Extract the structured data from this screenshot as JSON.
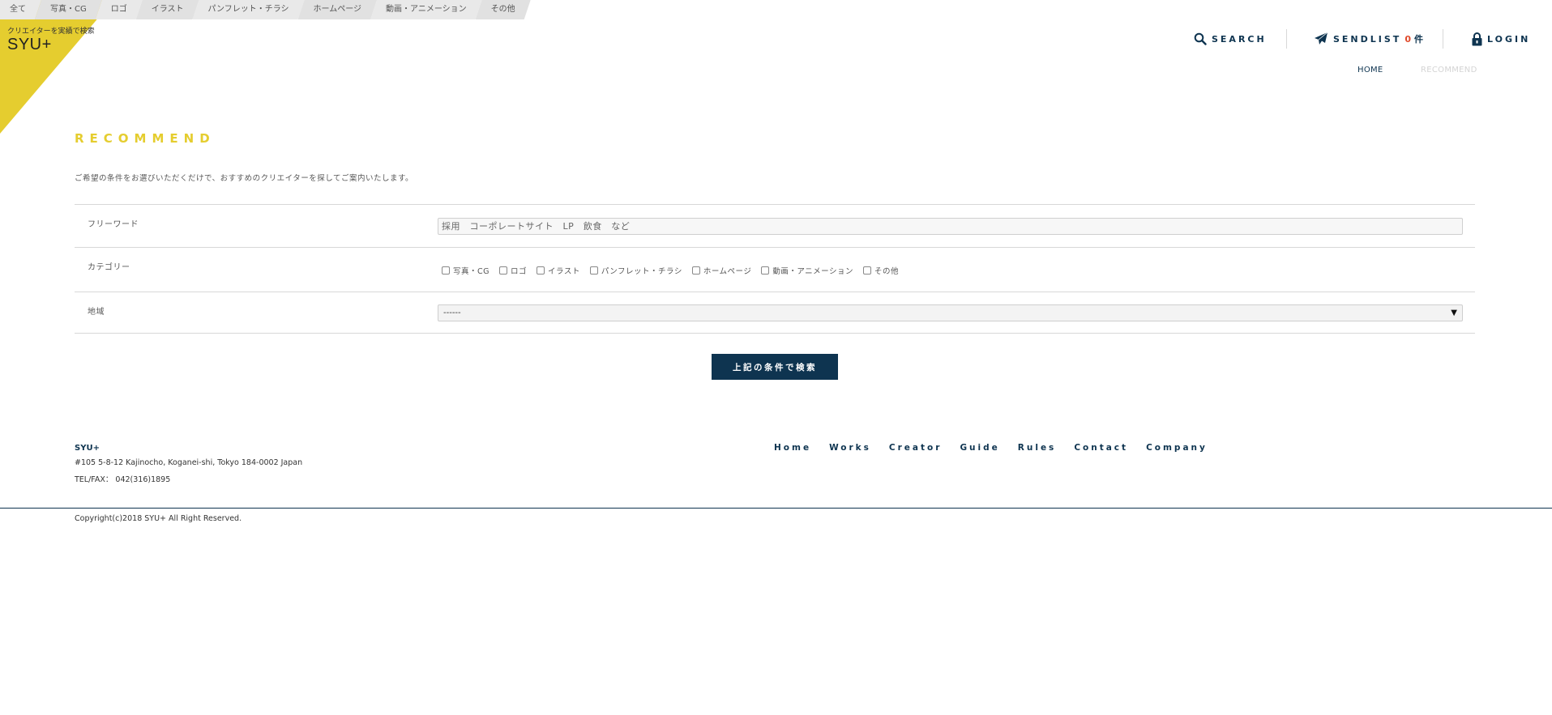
{
  "top_nav": {
    "items": [
      "全て",
      "写真・CG",
      "ロゴ",
      "イラスト",
      "パンフレット・チラシ",
      "ホームページ",
      "動画・アニメーション",
      "その他"
    ]
  },
  "logo": {
    "tagline": "クリエイターを実績で検索",
    "text": "SYU+"
  },
  "header": {
    "search_label": "SEARCH",
    "sendlist_label": "SENDLIST",
    "sendlist_count": "0",
    "sendlist_unit": "件",
    "login_label": "LOGIN"
  },
  "breadcrumb": {
    "home": "HOME",
    "current": "RECOMMEND"
  },
  "main": {
    "heading": "RECOMMEND",
    "intro": "ご希望の条件をお選びいただくだけで、おすすめのクリエイターを探してご案内いたします。"
  },
  "form": {
    "freeword_label": "フリーワード",
    "freeword_placeholder": "採用　コーポレートサイト　LP　飲食　など",
    "category_label": "カテゴリー",
    "categories": [
      "写真・CG",
      "ロゴ",
      "イラスト",
      "パンフレット・チラシ",
      "ホームページ",
      "動画・アニメーション",
      "その他"
    ],
    "region_label": "地域",
    "region_selected": "------",
    "submit_label": "上記の条件で検索"
  },
  "footer": {
    "brand": "SYU+",
    "address": "#105 5-8-12 Kajinocho, Koganei-shi, Tokyo 184-0002 Japan",
    "tel": "TEL/FAX：  042(316)1895",
    "links": [
      "Home",
      "Works",
      "Creator",
      "Guide",
      "Rules",
      "Contact",
      "Company"
    ],
    "copyright": "Copyright(c)2018 SYU+ All Right Reserved."
  },
  "colors": {
    "accent_yellow": "#e5cd2f",
    "navy": "#0e3450",
    "count_red": "#e04a2c"
  }
}
